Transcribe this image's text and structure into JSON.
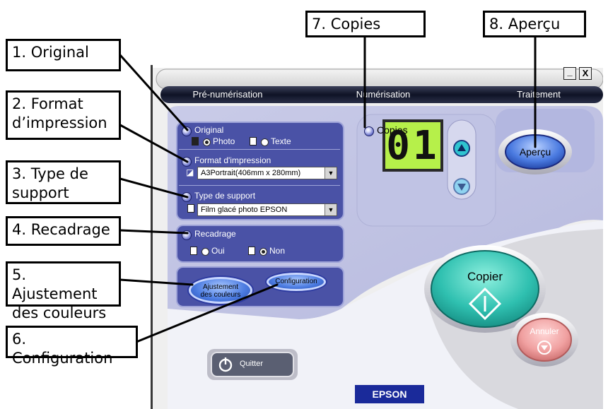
{
  "callouts": {
    "c1": "1. Original",
    "c2": "2. Format\nd’impression",
    "c3": "3. Type de\nsupport",
    "c4": "4. Recadrage",
    "c5": "5. Ajustement\ndes couleurs",
    "c6": "6. Configuration",
    "c7": "7. Copies",
    "c8": "8. Aperçu"
  },
  "tabs": [
    "Pré-numérisation",
    "Numérisation",
    "Traitement"
  ],
  "window_controls": {
    "minimize": "_",
    "close": "X"
  },
  "original": {
    "title": "Original",
    "photo": "Photo",
    "texte": "Texte",
    "selected": "Photo"
  },
  "format": {
    "title": "Format d'impression",
    "value": "A3Portrait(406mm x 280mm)"
  },
  "support": {
    "title": "Type de support",
    "value": "Film glacé photo EPSON"
  },
  "recadrage": {
    "title": "Recadrage",
    "oui": "Oui",
    "non": "Non",
    "selected": "Non"
  },
  "buttons": {
    "ajustement": "Ajustement\ndes couleurs",
    "configuration": "Configuration",
    "apercu": "Aperçu",
    "copier": "Copier",
    "annuler": "Annuler",
    "quitter": "Quitter"
  },
  "copies": {
    "label": "Copies",
    "value": "01"
  },
  "brand": "EPSON",
  "colors": {
    "panel_blue": "#4a52a6",
    "lcd_green": "#b6f04a",
    "copier_teal": "#2fc0b0",
    "annuler_pink": "#f0a0a0",
    "brand_blue": "#1a2a9a"
  }
}
